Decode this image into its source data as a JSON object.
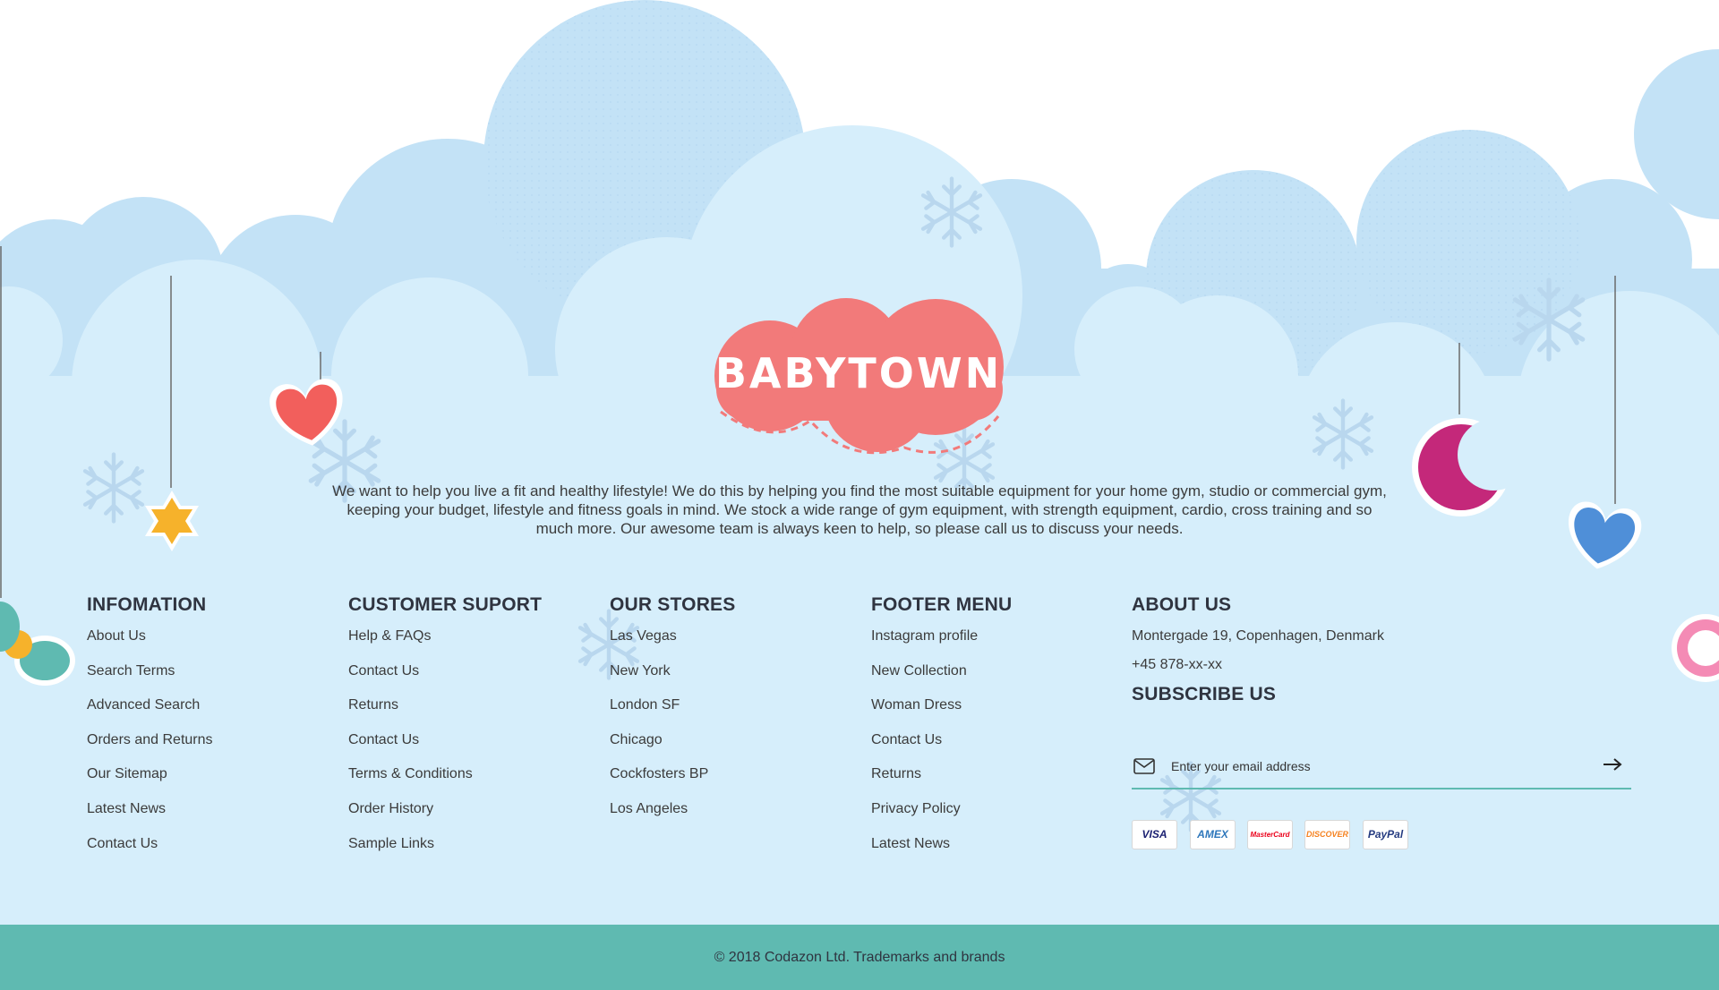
{
  "brand": {
    "logo_text": "BABYTOWN"
  },
  "intro": "We want to help you live a fit and healthy lifestyle! We do this by helping you find the most suitable equipment for your home gym, studio or commercial gym, keeping your budget, lifestyle and fitness goals in mind. We stock a wide range of gym equipment, with strength equipment, cardio, cross training and so much more. Our awesome team is always keen to help, so please call us to discuss your needs.",
  "columns": [
    {
      "title": "INFOMATION",
      "links": [
        "About Us",
        "Search Terms",
        "Advanced Search",
        "Orders and Returns",
        "Our Sitemap",
        "Latest News",
        "Contact Us"
      ]
    },
    {
      "title": "CUSTOMER SUPORT",
      "links": [
        "Help & FAQs",
        "Contact Us",
        "Returns",
        "Contact Us",
        "Terms & Conditions",
        "Order History",
        "Sample Links"
      ]
    },
    {
      "title": "OUR STORES",
      "links": [
        "Las Vegas",
        "New York",
        "London SF",
        "Chicago",
        "Cockfosters BP",
        "Los Angeles"
      ]
    },
    {
      "title": "FOOTER MENU",
      "links": [
        "Instagram profile",
        "New Collection",
        "Woman Dress",
        "Contact Us",
        "Returns",
        "Privacy Policy",
        "Latest News"
      ]
    }
  ],
  "about": {
    "title": "ABOUT US",
    "address": "Montergade 19, Copenhagen, Denmark",
    "phone": "+45 878-xx-xx"
  },
  "subscribe": {
    "title": "SUBSCRIBE US",
    "placeholder": "Enter your email address"
  },
  "payments": [
    {
      "label": "VISA",
      "color": "#1a1f71"
    },
    {
      "label": "AMEX",
      "color": "#2e77bb"
    },
    {
      "label": "MasterCard",
      "color": "#eb001b"
    },
    {
      "label": "DISCOVER",
      "color": "#f58220"
    },
    {
      "label": "PayPal",
      "color": "#253b80"
    }
  ],
  "copyright": "© 2018 Codazon Ltd. Trademarks and brands",
  "colors": {
    "cloud_light": "#d6eefb",
    "cloud_mid": "#c3e2f6",
    "logo": "#f27a7a",
    "footer_bar": "#5fbab1",
    "heart_red": "#f25f5c",
    "moon": "#c4287a",
    "heart_blue": "#4f8fd8",
    "star": "#f6b22b"
  },
  "icons": [
    "snowflake-icon",
    "mail-icon",
    "arrow-right-icon"
  ]
}
